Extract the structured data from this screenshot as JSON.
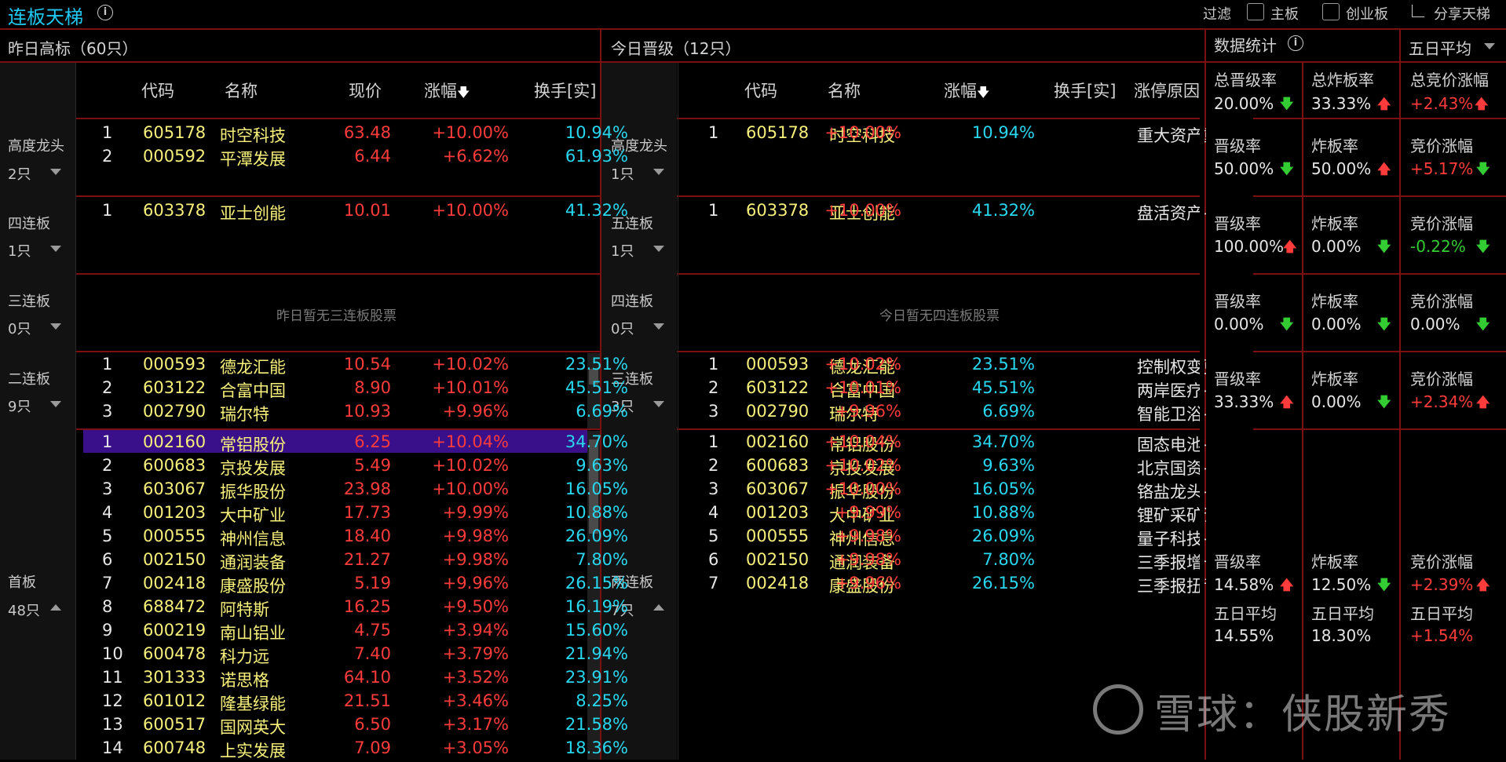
{
  "app": {
    "title": "连板天梯",
    "filter_label": "过滤",
    "main_board_label": "主板",
    "chinext_label": "创业板",
    "share_label": "分享天梯"
  },
  "colors": {
    "red": "#ff3b3b",
    "green": "#33cc33",
    "yellow": "#f6f07a",
    "cyan": "#27d8ef",
    "border": "#7a1010",
    "highlight": "#3a0f8a"
  },
  "left": {
    "title": "昨日高标（60只）",
    "headers": {
      "code": "代码",
      "name": "名称",
      "price": "现价",
      "change": "涨幅",
      "turnover": "换手[实]"
    },
    "groups": [
      {
        "name": "高度龙头",
        "count": "2只",
        "rows": [
          {
            "idx": "1",
            "code": "605178",
            "name": "时空科技",
            "price": "63.48",
            "change": "+10.00%",
            "turnover": "10.94%"
          },
          {
            "idx": "2",
            "code": "000592",
            "name": "平潭发展",
            "price": "6.44",
            "change": "+6.62%",
            "turnover": "61.93%"
          }
        ]
      },
      {
        "name": "四连板",
        "count": "1只",
        "rows": [
          {
            "idx": "1",
            "code": "603378",
            "name": "亚士创能",
            "price": "10.01",
            "change": "+10.00%",
            "turnover": "41.32%"
          }
        ]
      },
      {
        "name": "三连板",
        "count": "0只",
        "empty": "昨日暂无三连板股票",
        "rows": []
      },
      {
        "name": "二连板",
        "count": "9只",
        "rows": [
          {
            "idx": "1",
            "code": "000593",
            "name": "德龙汇能",
            "price": "10.54",
            "change": "+10.02%",
            "turnover": "23.51%"
          },
          {
            "idx": "2",
            "code": "603122",
            "name": "合富中国",
            "price": "8.90",
            "change": "+10.01%",
            "turnover": "45.51%"
          },
          {
            "idx": "3",
            "code": "002790",
            "name": "瑞尔特",
            "price": "10.93",
            "change": "+9.96%",
            "turnover": "6.69%"
          }
        ]
      },
      {
        "name": "首板",
        "count": "48只",
        "rows": [
          {
            "idx": "1",
            "code": "002160",
            "name": "常铝股份",
            "price": "6.25",
            "change": "+10.04%",
            "turnover": "34.70%"
          },
          {
            "idx": "2",
            "code": "600683",
            "name": "京投发展",
            "price": "5.49",
            "change": "+10.02%",
            "turnover": "9.63%"
          },
          {
            "idx": "3",
            "code": "603067",
            "name": "振华股份",
            "price": "23.98",
            "change": "+10.00%",
            "turnover": "16.05%"
          },
          {
            "idx": "4",
            "code": "001203",
            "name": "大中矿业",
            "price": "17.73",
            "change": "+9.99%",
            "turnover": "10.88%"
          },
          {
            "idx": "5",
            "code": "000555",
            "name": "神州信息",
            "price": "18.40",
            "change": "+9.98%",
            "turnover": "26.09%"
          },
          {
            "idx": "6",
            "code": "002150",
            "name": "通润装备",
            "price": "21.27",
            "change": "+9.98%",
            "turnover": "7.80%"
          },
          {
            "idx": "7",
            "code": "002418",
            "name": "康盛股份",
            "price": "5.19",
            "change": "+9.96%",
            "turnover": "26.15%"
          },
          {
            "idx": "8",
            "code": "688472",
            "name": "阿特斯",
            "price": "16.25",
            "change": "+9.50%",
            "turnover": "16.19%"
          },
          {
            "idx": "9",
            "code": "600219",
            "name": "南山铝业",
            "price": "4.75",
            "change": "+3.94%",
            "turnover": "15.60%"
          },
          {
            "idx": "10",
            "code": "600478",
            "name": "科力远",
            "price": "7.40",
            "change": "+3.79%",
            "turnover": "21.94%"
          },
          {
            "idx": "11",
            "code": "301333",
            "name": "诺思格",
            "price": "64.10",
            "change": "+3.52%",
            "turnover": "23.91%"
          },
          {
            "idx": "12",
            "code": "601012",
            "name": "隆基绿能",
            "price": "21.51",
            "change": "+3.46%",
            "turnover": "8.25%"
          },
          {
            "idx": "13",
            "code": "600517",
            "name": "国网英大",
            "price": "6.50",
            "change": "+3.17%",
            "turnover": "21.58%"
          },
          {
            "idx": "14",
            "code": "600748",
            "name": "上实发展",
            "price": "7.09",
            "change": "+3.05%",
            "turnover": "18.36%"
          }
        ]
      }
    ]
  },
  "mid": {
    "title": "今日晋级（12只）",
    "headers": {
      "code": "代码",
      "name": "名称",
      "change": "涨幅",
      "turnover": "换手[实]",
      "reason": "涨停原因"
    },
    "groups": [
      {
        "name": "高度龙头",
        "count": "1只",
        "rows": [
          {
            "idx": "1",
            "code": "605178",
            "name": "时空科技",
            "change": "+10.00%",
            "turnover": "10.94%",
            "reason": "重大资产重"
          }
        ]
      },
      {
        "name": "五连板",
        "count": "1只",
        "rows": [
          {
            "idx": "1",
            "code": "603378",
            "name": "亚士创能",
            "change": "+10.00%",
            "turnover": "41.32%",
            "reason": "盘活资产+"
          }
        ]
      },
      {
        "name": "四连板",
        "count": "0只",
        "empty": "今日暂无四连板股票",
        "rows": []
      },
      {
        "name": "三连板",
        "count": "3只",
        "rows": [
          {
            "idx": "1",
            "code": "000593",
            "name": "德龙汇能",
            "change": "+10.02%",
            "turnover": "23.51%",
            "reason": "控制权变更"
          },
          {
            "idx": "2",
            "code": "603122",
            "name": "合富中国",
            "change": "+10.01%",
            "turnover": "45.51%",
            "reason": "两岸医疗+"
          },
          {
            "idx": "3",
            "code": "002790",
            "name": "瑞尔特",
            "change": "+9.96%",
            "turnover": "6.69%",
            "reason": "智能卫浴+"
          }
        ]
      },
      {
        "name": "两连板",
        "count": "7只",
        "rows": [
          {
            "idx": "1",
            "code": "002160",
            "name": "常铝股份",
            "change": "+10.04%",
            "turnover": "34.70%",
            "reason": "固态电池+"
          },
          {
            "idx": "2",
            "code": "600683",
            "name": "京投发展",
            "change": "+10.02%",
            "turnover": "9.63%",
            "reason": "北京国资+"
          },
          {
            "idx": "3",
            "code": "603067",
            "name": "振华股份",
            "change": "+10.00%",
            "turnover": "16.05%",
            "reason": "铬盐龙头+"
          },
          {
            "idx": "4",
            "code": "001203",
            "name": "大中矿业",
            "change": "+9.99%",
            "turnover": "10.88%",
            "reason": "锂矿采矿证"
          },
          {
            "idx": "5",
            "code": "000555",
            "name": "神州信息",
            "change": "+9.98%",
            "turnover": "26.09%",
            "reason": "量子科技+"
          },
          {
            "idx": "6",
            "code": "002150",
            "name": "通润装备",
            "change": "+9.98%",
            "turnover": "7.80%",
            "reason": "三季报增长"
          },
          {
            "idx": "7",
            "code": "002418",
            "name": "康盛股份",
            "change": "+9.96%",
            "turnover": "26.15%",
            "reason": "三季报扭亏"
          }
        ]
      }
    ]
  },
  "stats": {
    "title": "数据统计",
    "period_select": "五日平均",
    "summary": [
      {
        "label": "总晋级率",
        "value": "20.00%",
        "dir": "down"
      },
      {
        "label": "总炸板率",
        "value": "33.33%",
        "dir": "up"
      },
      {
        "label": "总竞价涨幅",
        "value": "+2.43%",
        "dir": "up"
      }
    ],
    "groups": [
      [
        {
          "label": "晋级率",
          "value": "50.00%",
          "dir": "down"
        },
        {
          "label": "炸板率",
          "value": "50.00%",
          "dir": "up"
        },
        {
          "label": "竞价涨幅",
          "value": "+5.17%",
          "dir": "down"
        }
      ],
      [
        {
          "label": "晋级率",
          "value": "100.00%",
          "dir": "up"
        },
        {
          "label": "炸板率",
          "value": "0.00%",
          "dir": "down"
        },
        {
          "label": "竞价涨幅",
          "value": "-0.22%",
          "dir": "down"
        }
      ],
      [
        {
          "label": "晋级率",
          "value": "0.00%",
          "dir": "down"
        },
        {
          "label": "炸板率",
          "value": "0.00%",
          "dir": "down"
        },
        {
          "label": "竞价涨幅",
          "value": "0.00%",
          "dir": "down"
        }
      ],
      [
        {
          "label": "晋级率",
          "value": "33.33%",
          "dir": "up"
        },
        {
          "label": "炸板率",
          "value": "0.00%",
          "dir": "down"
        },
        {
          "label": "竞价涨幅",
          "value": "+2.34%",
          "dir": "up"
        }
      ],
      [
        {
          "label": "晋级率",
          "value": "14.58%",
          "dir": "up"
        },
        {
          "label": "炸板率",
          "value": "12.50%",
          "dir": "down"
        },
        {
          "label": "竞价涨幅",
          "value": "+2.39%",
          "dir": "up"
        }
      ]
    ],
    "avg": [
      {
        "label": "五日平均",
        "value": "14.55%"
      },
      {
        "label": "五日平均",
        "value": "18.30%"
      },
      {
        "label": "五日平均",
        "value": "+1.54%"
      }
    ]
  },
  "watermark": "雪球：侠股新秀"
}
